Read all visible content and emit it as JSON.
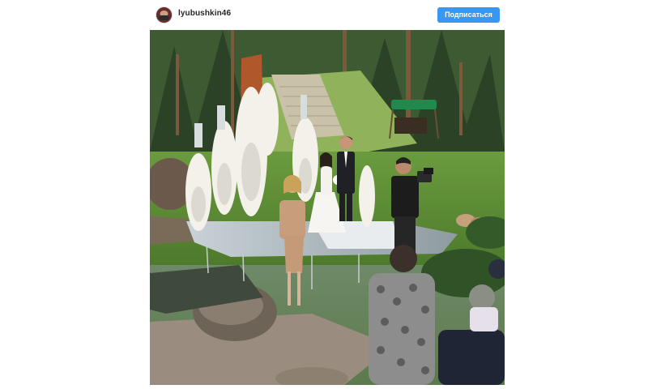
{
  "post": {
    "username": "lyubushkin46",
    "follow_label": "Подписаться",
    "avatar_icon": "user-avatar-icon"
  },
  "colors": {
    "follow_button": "#3897f0",
    "username_text": "#262626",
    "background": "#ffffff"
  }
}
